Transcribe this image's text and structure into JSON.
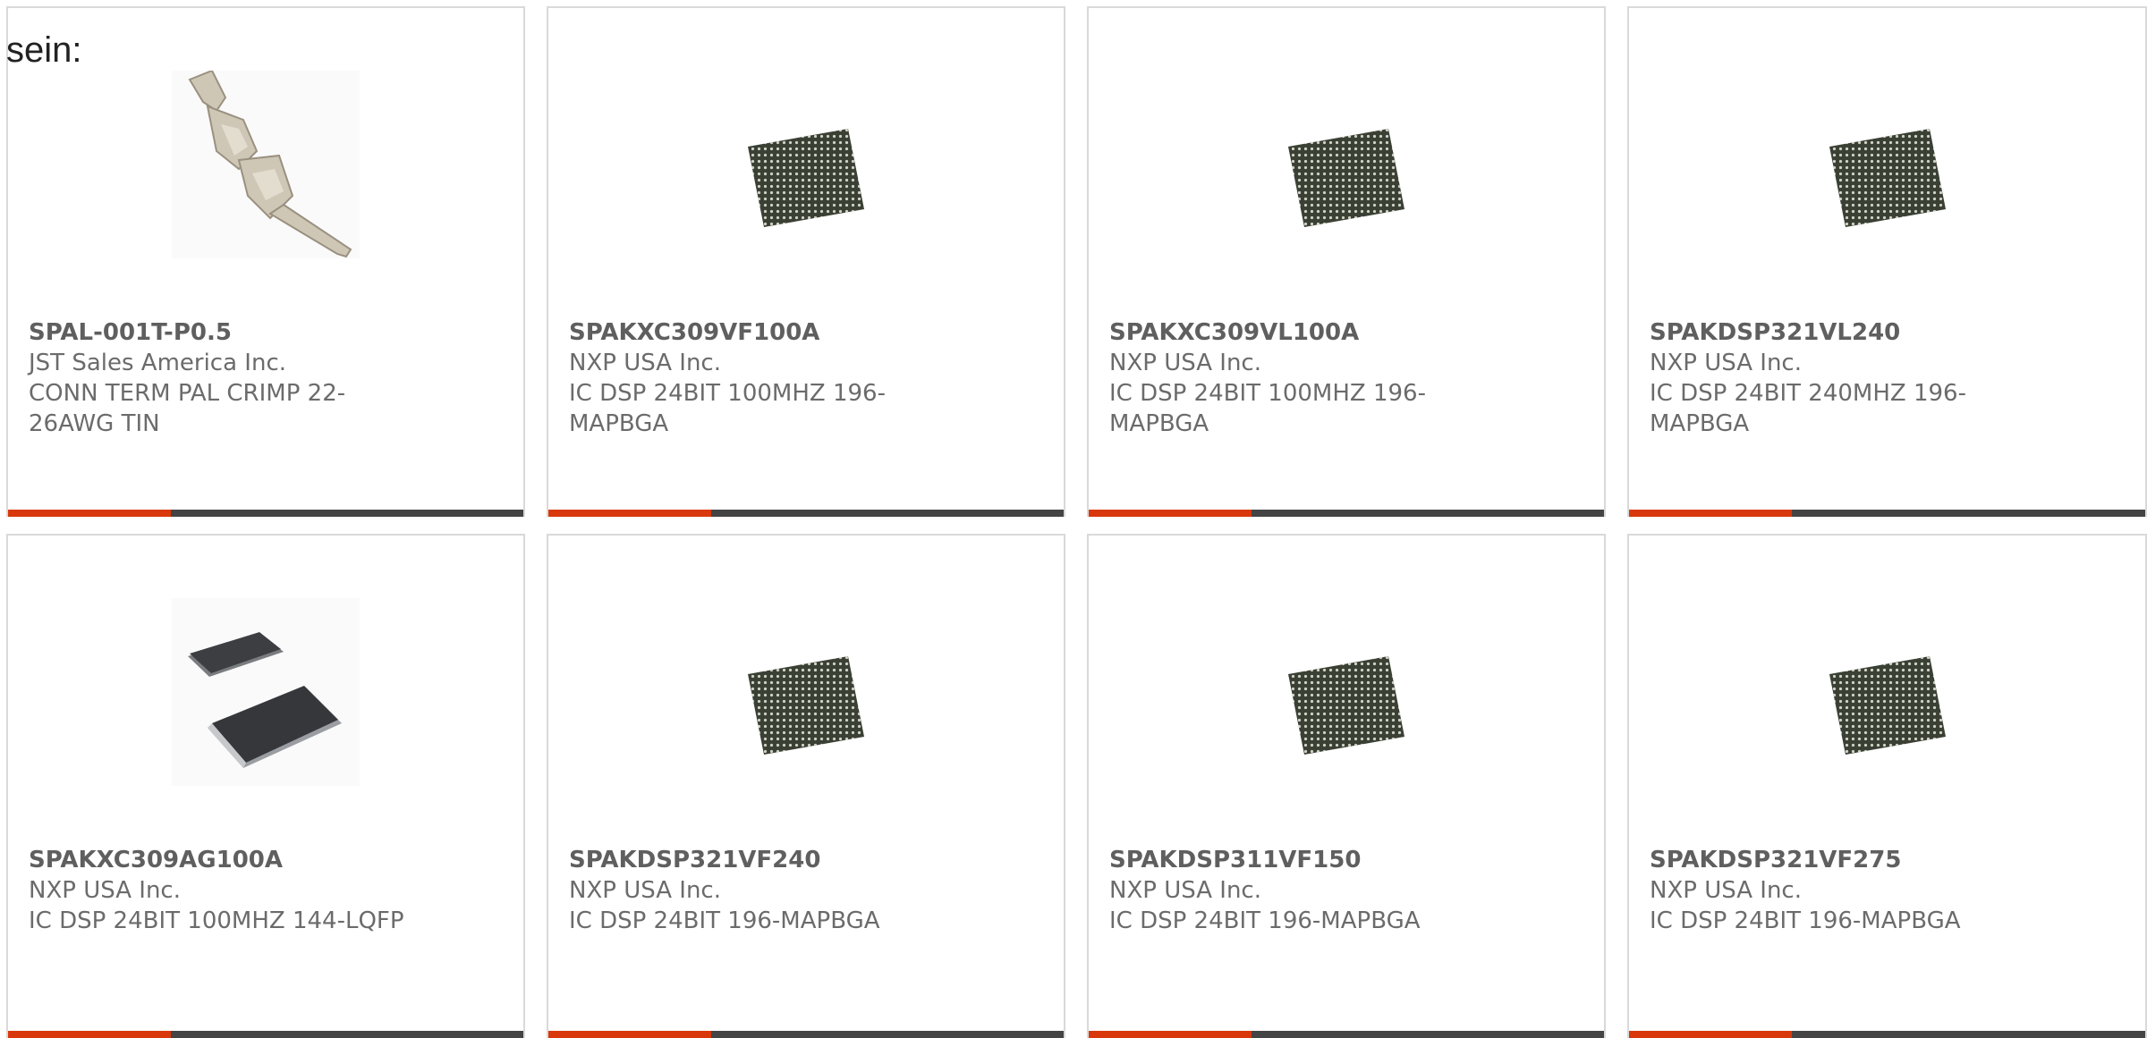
{
  "intro_text": "sein:",
  "accent_color": "#d8380b",
  "products": [
    {
      "part_number": "SPAL-001T-P0.5",
      "manufacturer": "JST Sales America Inc.",
      "description": "CONN TERM PAL CRIMP 22-26AWG TIN",
      "image": "crimp-terminal-icon"
    },
    {
      "part_number": "SPAKXC309VF100A",
      "manufacturer": "NXP USA Inc.",
      "description": "IC DSP 24BIT 100MHZ 196-MAPBGA",
      "image": "bga-chip-icon"
    },
    {
      "part_number": "SPAKXC309VL100A",
      "manufacturer": "NXP USA Inc.",
      "description": "IC DSP 24BIT 100MHZ 196-MAPBGA",
      "image": "bga-chip-icon"
    },
    {
      "part_number": "SPAKDSP321VL240",
      "manufacturer": "NXP USA Inc.",
      "description": "IC DSP 24BIT 240MHZ 196-MAPBGA",
      "image": "bga-chip-icon"
    },
    {
      "part_number": "SPAKXC309AG100A",
      "manufacturer": "NXP USA Inc.",
      "description": "IC DSP 24BIT 100MHZ 144-LQFP",
      "image": "lqfp-chip-icon"
    },
    {
      "part_number": "SPAKDSP321VF240",
      "manufacturer": "NXP USA Inc.",
      "description": "IC DSP 24BIT 196-MAPBGA",
      "image": "bga-chip-icon"
    },
    {
      "part_number": "SPAKDSP311VF150",
      "manufacturer": "NXP USA Inc.",
      "description": "IC DSP 24BIT 196-MAPBGA",
      "image": "bga-chip-icon"
    },
    {
      "part_number": "SPAKDSP321VF275",
      "manufacturer": "NXP USA Inc.",
      "description": "IC DSP 24BIT 196-MAPBGA",
      "image": "bga-chip-icon"
    }
  ]
}
